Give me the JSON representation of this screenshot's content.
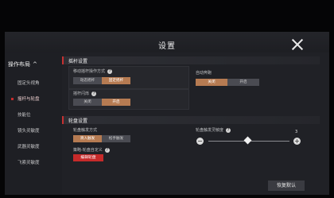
{
  "header": {
    "title": "设置"
  },
  "sidebar": {
    "heading": "操作布局",
    "caret": "^",
    "items": [
      {
        "label": "固定头视角"
      },
      {
        "label": "摇杆与轮盘"
      },
      {
        "label": "技能位"
      },
      {
        "label": "镜头灵敏度"
      },
      {
        "label": "武器灵敏度"
      },
      {
        "label": "飞索灵敏度"
      }
    ]
  },
  "sections": {
    "joystick": {
      "title": "摇杆设置",
      "mode_label": "移动摇杆操作方式",
      "mode_options": [
        "动态摇杆",
        "固定摇杆"
      ],
      "auto_run_label": "自动奔跑",
      "auto_run_options": [
        "关闭",
        "开启"
      ],
      "lock_label": "摇杆闪烁",
      "lock_options": [
        "关闭",
        "开启"
      ]
    },
    "wheel": {
      "title": "轮盘设置",
      "trigger_label": "轮盘触发方式",
      "trigger_options": [
        "滑入触发",
        "松手触发"
      ],
      "sensitivity_label": "轮盘触发灵敏度",
      "sensitivity_value": "3",
      "custom_label": "策略-轮盘自定义",
      "custom_button": "编辑轮盘"
    }
  },
  "footer": {
    "restore_label": "恢复默认"
  },
  "colors": {
    "accent": "#c62a2a",
    "selected": "#b67b52"
  }
}
